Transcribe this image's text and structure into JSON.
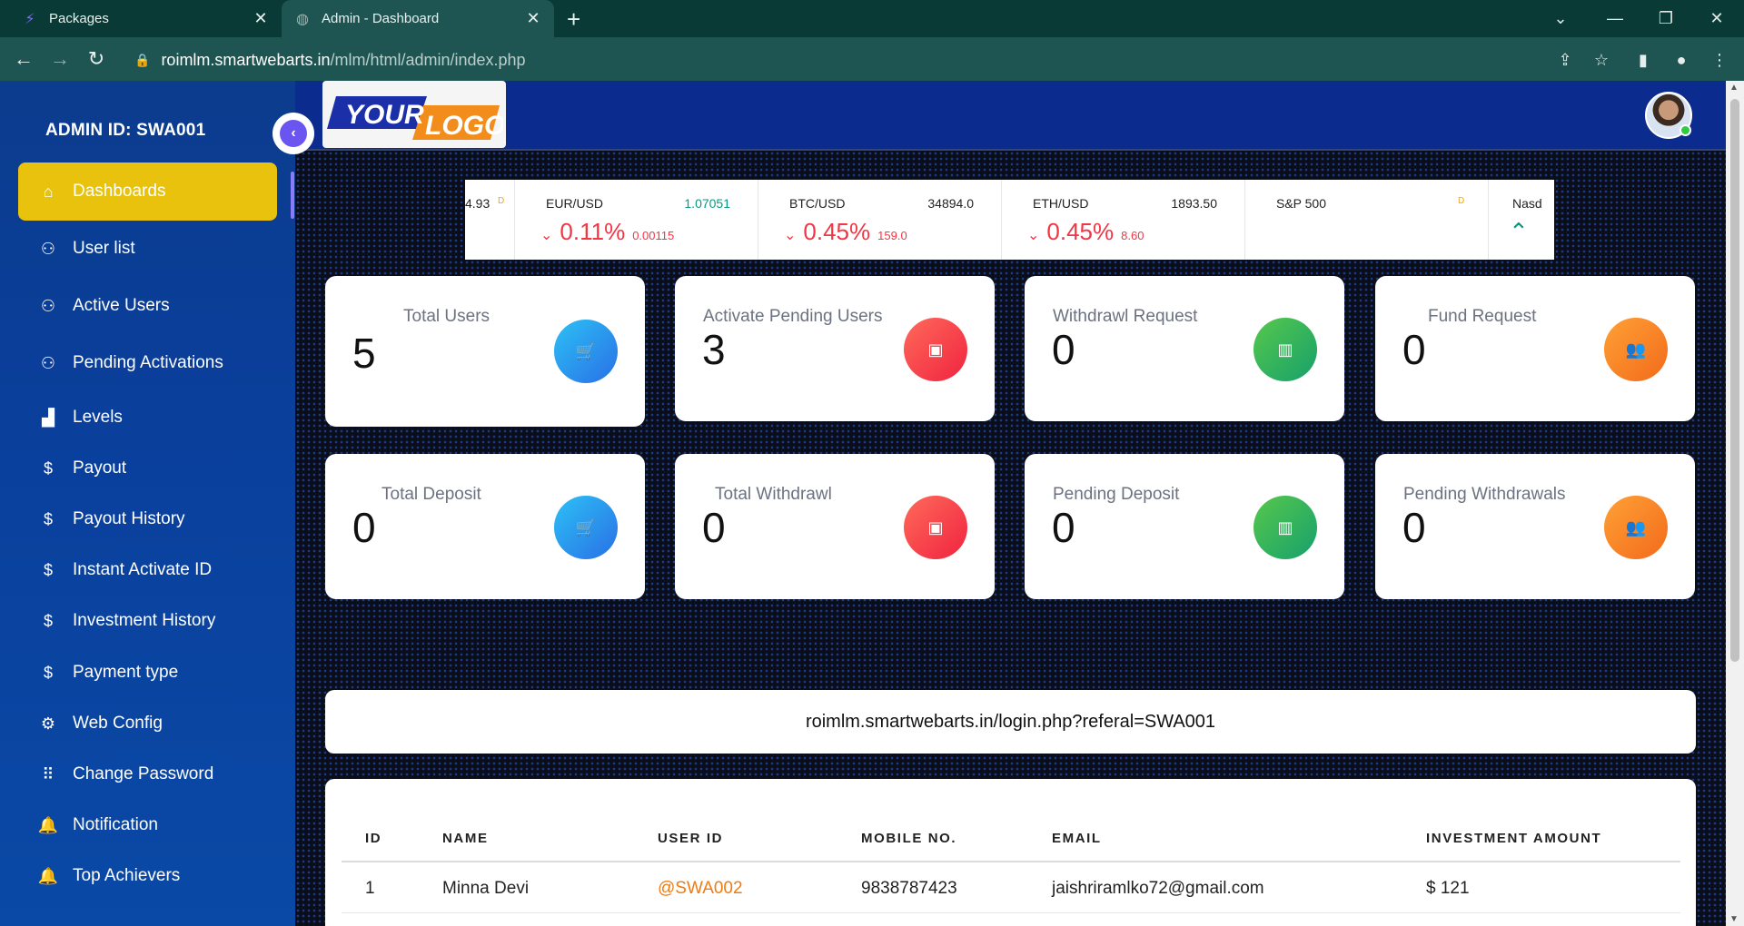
{
  "browser": {
    "tabs": [
      {
        "title": "Packages",
        "icon": "lightning-icon",
        "active": false
      },
      {
        "title": "Admin - Dashboard",
        "icon": "globe-icon",
        "active": true
      }
    ],
    "url_host": "roimlm.smartwebarts.in",
    "url_path": "/mlm/html/admin/index.php"
  },
  "sidebar": {
    "admin_id": "ADMIN ID: SWA001",
    "items": [
      {
        "label": "Dashboards",
        "icon": "home-icon",
        "active": true
      },
      {
        "label": "User list",
        "icon": "user-icon"
      },
      {
        "label": "Active Users",
        "icon": "user-icon"
      },
      {
        "label": "Pending Activations",
        "icon": "user-icon"
      },
      {
        "label": "Levels",
        "icon": "bar-chart-icon"
      },
      {
        "label": "Payout",
        "icon": "dollar-icon"
      },
      {
        "label": "Payout History",
        "icon": "dollar-icon"
      },
      {
        "label": "Instant Activate ID",
        "icon": "dollar-icon"
      },
      {
        "label": "Investment History",
        "icon": "dollar-icon"
      },
      {
        "label": "Payment type",
        "icon": "dollar-icon"
      },
      {
        "label": "Web Config",
        "icon": "gear-icon"
      },
      {
        "label": "Change Password",
        "icon": "grid-icon"
      },
      {
        "label": "Notification",
        "icon": "bell-icon"
      },
      {
        "label": "Top Achievers",
        "icon": "bell-icon"
      }
    ]
  },
  "header": {
    "logo_text_1": "YOUR",
    "logo_text_2": "LOGO"
  },
  "ticker": [
    {
      "sym": "",
      "price": "",
      "tail": "4.93",
      "chg": "",
      "abs": "",
      "dir": "none"
    },
    {
      "sym": "EUR/USD",
      "price": "1.07051",
      "chg": "0.11%",
      "abs": "0.00115",
      "dir": "down"
    },
    {
      "sym": "BTC/USD",
      "price": "34894.0",
      "chg": "0.45%",
      "abs": "159.0",
      "dir": "down"
    },
    {
      "sym": "ETH/USD",
      "price": "1893.50",
      "chg": "0.45%",
      "abs": "8.60",
      "dir": "down"
    },
    {
      "sym": "S&P 500",
      "price": "",
      "chg": "",
      "abs": "",
      "dir": "none"
    },
    {
      "sym": "Nasd",
      "price": "",
      "chg": "",
      "abs": "",
      "dir": "up"
    }
  ],
  "ticker_delayed_marker": "D",
  "cards": [
    {
      "label": "Total Users",
      "value": "5",
      "icon": "cart-icon",
      "color": "blue"
    },
    {
      "label": "Activate Pending Users",
      "value": "3",
      "icon": "wallet-icon",
      "color": "red"
    },
    {
      "label": "Withdrawl Request",
      "value": "0",
      "icon": "bar-chart-icon",
      "color": "green"
    },
    {
      "label": "Fund Request",
      "value": "0",
      "icon": "users-icon",
      "color": "orange"
    },
    {
      "label": "Total Deposit",
      "value": "0",
      "icon": "cart-icon",
      "color": "blue"
    },
    {
      "label": "Total Withdrawl",
      "value": "0",
      "icon": "wallet-icon",
      "color": "red"
    },
    {
      "label": "Pending Deposit",
      "value": "0",
      "icon": "bar-chart-icon",
      "color": "green"
    },
    {
      "label": "Pending Withdrawals",
      "value": "0",
      "icon": "users-icon",
      "color": "orange"
    }
  ],
  "referral_link": "roimlm.smartwebarts.in/login.php?referal=SWA001",
  "table": {
    "columns": [
      "ID",
      "NAME",
      "USER ID",
      "MOBILE NO.",
      "EMAIL",
      "INVESTMENT AMOUNT"
    ],
    "rows": [
      [
        "1",
        "Minna Devi",
        "@SWA002",
        "9838787423",
        "jaishriramlko72@gmail.com",
        "$ 121"
      ]
    ]
  },
  "colors": {
    "sidebar_active": "#e8c20d",
    "header_bg": "#0b2c8e",
    "link_orange": "#f07b12",
    "ticker_down": "#f23645",
    "ticker_up": "#089981"
  }
}
